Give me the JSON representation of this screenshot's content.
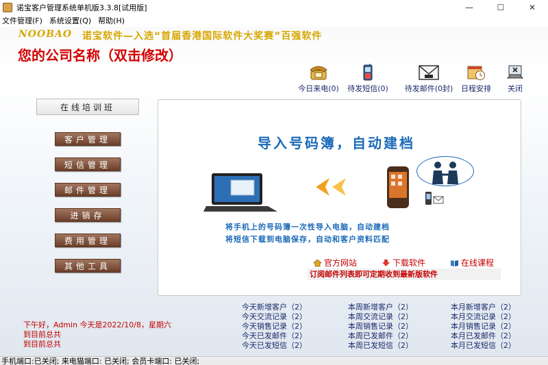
{
  "window": {
    "title": "诺宝客户管理系统单机版3.3.8[试用版]",
    "controls": [
      "—",
      "☐",
      "✕"
    ]
  },
  "menu": [
    "文件管理(F)",
    "系统设置(Q)",
    "帮助(H)"
  ],
  "banner": {
    "logo": "NOOBAO",
    "slogan": "诺宝软件—入选“首届香港国际软件大奖赛”百强软件",
    "company": "您的公司名称（双击修改）"
  },
  "toolbar": [
    {
      "label": "今日来电(0)",
      "icon": "telephone-icon"
    },
    {
      "label": "待发短信(0)",
      "icon": "mobile-phone-icon"
    },
    {
      "label": "待发邮件(0封)",
      "icon": "mail-icon"
    },
    {
      "label": "日程安排",
      "icon": "calendar-clock-icon"
    },
    {
      "label": "关闭",
      "icon": "close-app-icon"
    }
  ],
  "sidebar": {
    "training": "在线培训班",
    "items": [
      "客户管理",
      "短信管理",
      "邮件管理",
      "进销存",
      "费用管理",
      "其他工具"
    ]
  },
  "promo": {
    "title": "导入号码簿，自动建档",
    "line1": "将手机上的号码簿一次性导入电脑，自动建档",
    "line2": "将短信下载到电脑保存，自动和客户资料匹配",
    "links": [
      "官方网站",
      "下载软件",
      "在线课程"
    ],
    "subscribe": "订阅邮件列表即可定期收到最新版软件"
  },
  "greeting": "下午好，Admin  今天是2022/10/8，星期六",
  "totals": [
    "到目前总共",
    "到目前总共"
  ],
  "stats": {
    "today": [
      "今天新增客户（2）",
      "今天交流记录（2）",
      "今天销售记录（2）",
      "今天已发邮件（2）",
      "今天已发短信（2）"
    ],
    "week": [
      "本周新增客户（2）",
      "本周交流记录（2）",
      "本周销售记录（2）",
      "本周已发邮件（2）",
      "本周已发短信（2）"
    ],
    "month": [
      "本月新增客户（2）",
      "本月交流记录（2）",
      "本月销售记录（2）",
      "本月已发邮件（2）",
      "本月已发短信（2）"
    ]
  },
  "statusbar": "手机端口:已关闭; 来电猫端口: 已关闭; 会员卡端口: 已关闭;",
  "colors": {
    "accent_red": "#d40000",
    "link_blue": "#1b6ab8",
    "nav_brown": "#7a4a33",
    "slogan_gold": "#d6a700"
  }
}
